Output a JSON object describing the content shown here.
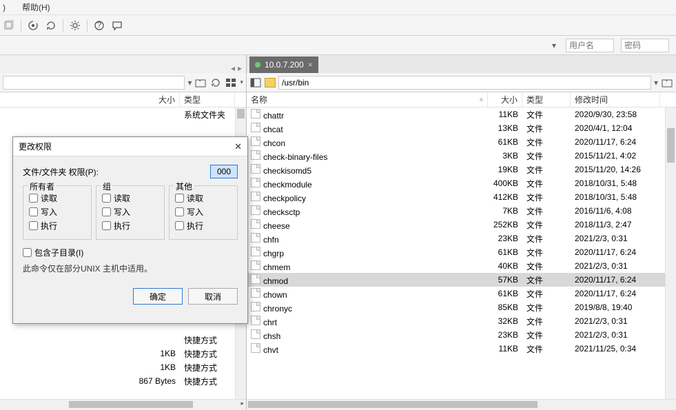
{
  "menu": {
    "m1_suffix": ")",
    "help": "帮助(H)"
  },
  "connect": {
    "user_ph": "用户名",
    "pass_ph": "密码"
  },
  "tab": {
    "ip": "10.0.7.200"
  },
  "right": {
    "path": "/usr/bin",
    "headers": {
      "name": "名称",
      "size": "大小",
      "type": "类型",
      "date": "修改时间"
    },
    "rows": [
      {
        "name": "chattr",
        "size": "11KB",
        "type": "文件",
        "date": "2020/9/30, 23:58",
        "sel": false
      },
      {
        "name": "chcat",
        "size": "13KB",
        "type": "文件",
        "date": "2020/4/1, 12:04",
        "sel": false
      },
      {
        "name": "chcon",
        "size": "61KB",
        "type": "文件",
        "date": "2020/11/17, 6:24",
        "sel": false
      },
      {
        "name": "check-binary-files",
        "size": "3KB",
        "type": "文件",
        "date": "2015/11/21, 4:02",
        "sel": false
      },
      {
        "name": "checkisomd5",
        "size": "19KB",
        "type": "文件",
        "date": "2015/11/20, 14:26",
        "sel": false
      },
      {
        "name": "checkmodule",
        "size": "400KB",
        "type": "文件",
        "date": "2018/10/31, 5:48",
        "sel": false
      },
      {
        "name": "checkpolicy",
        "size": "412KB",
        "type": "文件",
        "date": "2018/10/31, 5:48",
        "sel": false
      },
      {
        "name": "checksctp",
        "size": "7KB",
        "type": "文件",
        "date": "2016/11/6, 4:08",
        "sel": false
      },
      {
        "name": "cheese",
        "size": "252KB",
        "type": "文件",
        "date": "2018/11/3, 2:47",
        "sel": false
      },
      {
        "name": "chfn",
        "size": "23KB",
        "type": "文件",
        "date": "2021/2/3, 0:31",
        "sel": false
      },
      {
        "name": "chgrp",
        "size": "61KB",
        "type": "文件",
        "date": "2020/11/17, 6:24",
        "sel": false
      },
      {
        "name": "chmem",
        "size": "40KB",
        "type": "文件",
        "date": "2021/2/3, 0:31",
        "sel": false
      },
      {
        "name": "chmod",
        "size": "57KB",
        "type": "文件",
        "date": "2020/11/17, 6:24",
        "sel": true
      },
      {
        "name": "chown",
        "size": "61KB",
        "type": "文件",
        "date": "2020/11/17, 6:24",
        "sel": false
      },
      {
        "name": "chronyc",
        "size": "85KB",
        "type": "文件",
        "date": "2019/8/8, 19:40",
        "sel": false
      },
      {
        "name": "chrt",
        "size": "32KB",
        "type": "文件",
        "date": "2021/2/3, 0:31",
        "sel": false
      },
      {
        "name": "chsh",
        "size": "23KB",
        "type": "文件",
        "date": "2021/2/3, 0:31",
        "sel": false
      },
      {
        "name": "chvt",
        "size": "11KB",
        "type": "文件",
        "date": "2021/11/25, 0:34",
        "sel": false
      }
    ]
  },
  "left": {
    "headers": {
      "size": "大小",
      "type": "类型"
    },
    "top_row": {
      "type": "系统文件夹"
    },
    "bottom_rows": [
      {
        "size": "",
        "type": "快捷方式"
      },
      {
        "size": "1KB",
        "type": "快捷方式"
      },
      {
        "size": "1KB",
        "type": "快捷方式"
      },
      {
        "size": "867 Bytes",
        "type": "快捷方式"
      }
    ]
  },
  "dialog": {
    "title": "更改权限",
    "label": "文件/文件夹 权限(P):",
    "value": "000",
    "groups": {
      "owner": "所有者",
      "group": "组",
      "other": "其他",
      "read": "读取",
      "write": "写入",
      "exec": "执行"
    },
    "include_sub": "包含子目录(I)",
    "note": "此命令仅在部分UNIX 主机中适用。",
    "ok": "确定",
    "cancel": "取消"
  }
}
